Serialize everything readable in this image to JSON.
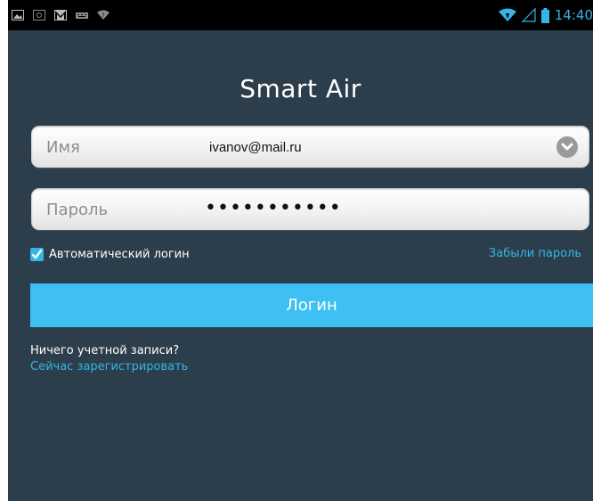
{
  "status_bar": {
    "time": "14:40",
    "left_icons": [
      "image-icon",
      "photo-icon",
      "gmail-icon",
      "keyboard-icon",
      "wifi-notification-icon"
    ],
    "right_icons": [
      "wifi-icon",
      "signal-icon",
      "battery-icon"
    ]
  },
  "app": {
    "title": "Smart Air"
  },
  "login_form": {
    "username": {
      "label": "Имя",
      "value": "ivanov@mail.ru"
    },
    "password": {
      "label": "Пароль",
      "value": "•••••••••••"
    },
    "auto_login": {
      "label": "Автоматический логин",
      "checked": true
    },
    "forgot_password": "Забыли пароль",
    "login_button": "Логин",
    "no_account": "Ничего учетной записи?",
    "register_now": "Сейчас зарегистрировать"
  },
  "colors": {
    "background": "#2c3e4b",
    "accent": "#33b5e5",
    "button": "#3ec0f2"
  }
}
